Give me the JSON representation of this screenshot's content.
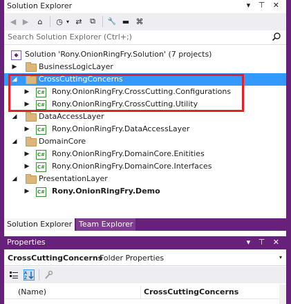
{
  "solution_explorer": {
    "title": "Solution Explorer",
    "title_icons": "▾ ⊤ ✕",
    "search_placeholder": "Search Solution Explorer (Ctrl+;)",
    "toolbar": {
      "back_icon": "◀",
      "forward_icon": "▶",
      "home_icon": "⌂",
      "history_icon": "◷",
      "dropdown_icon": "▾",
      "sync_icon": "⇄",
      "copy_icon": "⧉",
      "properties_icon": "🔧",
      "collapse_icon": "▬",
      "diagram_icon": "⌘"
    },
    "tree": {
      "solution": "Solution 'Rony.OnionRingFry.Solution' (7 projects)",
      "items": [
        {
          "label": "BusinessLogicLayer",
          "kind": "folder",
          "expander": "▶"
        },
        {
          "label": "CrossCuttingConcerns",
          "kind": "folder",
          "expander": "◢"
        },
        {
          "label": "Rony.OnionRingFry.CrossCutting.Configurations",
          "kind": "csproj",
          "expander": "▶"
        },
        {
          "label": "Rony.OnionRingFry.CrossCutting.Utility",
          "kind": "csproj",
          "expander": "▶"
        },
        {
          "label": "DataAccessLayer",
          "kind": "folder",
          "expander": "◢"
        },
        {
          "label": "Rony.OnionRingFry.DataAccessLayer",
          "kind": "csproj",
          "expander": "▶"
        },
        {
          "label": "DomainCore",
          "kind": "folder",
          "expander": "◢"
        },
        {
          "label": "Rony.OnionRingFry.DomainCore.Enitities",
          "kind": "csproj",
          "expander": "▶"
        },
        {
          "label": "Rony.OnionRingFry.DomainCore.Interfaces",
          "kind": "csproj",
          "expander": "▶"
        },
        {
          "label": "PresentationLayer",
          "kind": "folder",
          "expander": "◢"
        },
        {
          "label": "Rony.OnionRingFry.Demo",
          "kind": "csproj",
          "expander": "▶"
        }
      ]
    },
    "cs_badge": "C#"
  },
  "tabs": [
    {
      "label": "Solution Explorer"
    },
    {
      "label": "Team Explorer"
    }
  ],
  "properties": {
    "title": "Properties",
    "title_icons": "▾ ⊤ ✕",
    "selected_object": "CrossCuttingConcerns",
    "selected_type": "Folder Properties",
    "dropdown_arrow": "▾",
    "rows": [
      {
        "name": "(Name)",
        "value": "CrossCuttingConcerns"
      }
    ]
  },
  "colors": {
    "accent": "#68217a",
    "selection": "#3399ff",
    "highlight_box": "#e0202a"
  }
}
